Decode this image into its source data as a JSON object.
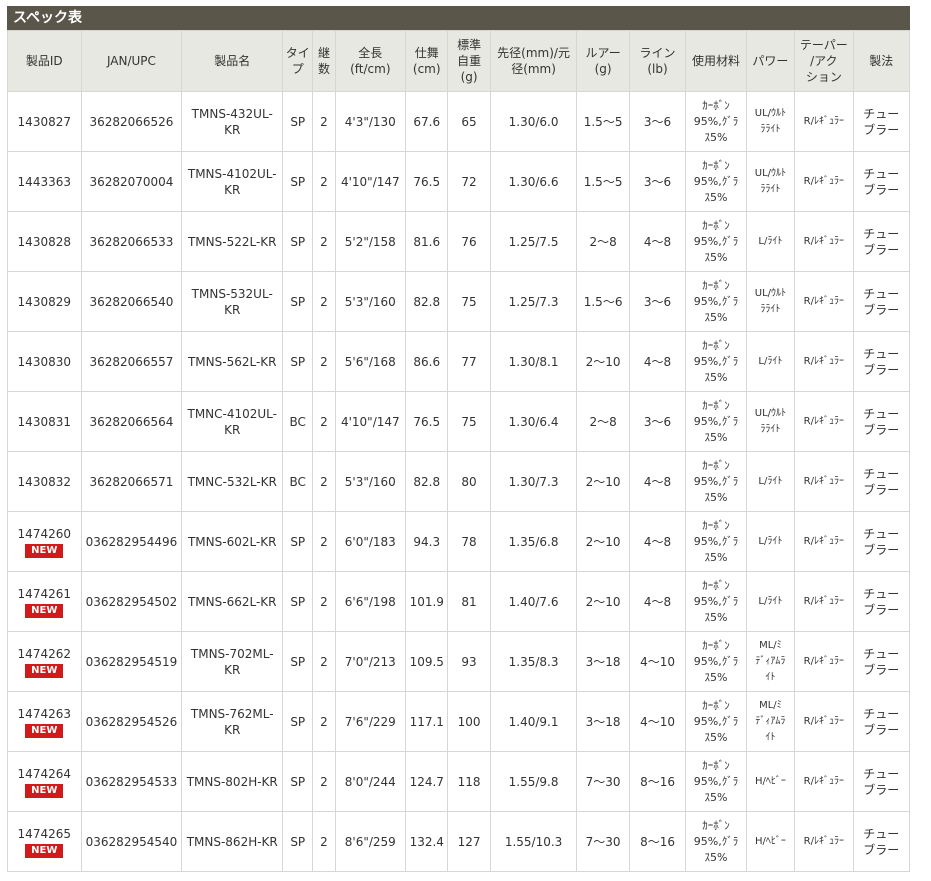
{
  "section_title": "スペック表",
  "headers": [
    "製品ID",
    "JAN/UPC",
    "製品名",
    "タイプ",
    "継数",
    "全長(ft/cm)",
    "仕舞(cm)",
    "標準自重(g)",
    "先径(mm)/元径(mm)",
    "ルアー(g)",
    "ライン(lb)",
    "使用材料",
    "パワー",
    "テーパー/アクション",
    "製法"
  ],
  "header_display": [
    [
      "製品ID"
    ],
    [
      "JAN/UPC"
    ],
    [
      "製品名"
    ],
    [
      "タイ",
      "プ"
    ],
    [
      "継",
      "数"
    ],
    [
      "全長",
      "(ft/cm)"
    ],
    [
      "仕舞",
      "(cm)"
    ],
    [
      "標準",
      "自重",
      "(g)"
    ],
    [
      "先径(mm)/元",
      "径(mm)"
    ],
    [
      "ルアー",
      "(g)"
    ],
    [
      "ライン",
      "(lb)"
    ],
    [
      "使用材料"
    ],
    [
      "パワー"
    ],
    [
      "テーパー",
      "/アク",
      "ション"
    ],
    [
      "製法"
    ]
  ],
  "new_label": "NEW",
  "rows": [
    {
      "id": "1430827",
      "new": false,
      "jan": "36282066526",
      "name": [
        "TMNS-432UL-",
        "KR"
      ],
      "type": "SP",
      "pieces": "2",
      "length": "4'3\"/130",
      "closed": "67.6",
      "weight": "65",
      "dia": "1.30/6.0",
      "lure": "1.5～5",
      "line": "3～6",
      "material": [
        "ｶｰﾎﾞﾝ",
        "95%,ｸﾞﾗ",
        "ｽ5%"
      ],
      "power": [
        "UL/ｳﾙﾄ",
        "ﾗﾗｲﾄ"
      ],
      "taper": "R/ﾚｷﾞｭﾗｰ",
      "method": [
        "チュー",
        "ブラー"
      ]
    },
    {
      "id": "1443363",
      "new": false,
      "jan": "36282070004",
      "name": [
        "TMNS-4102UL-",
        "KR"
      ],
      "type": "SP",
      "pieces": "2",
      "length": "4'10\"/147",
      "closed": "76.5",
      "weight": "72",
      "dia": "1.30/6.6",
      "lure": "1.5～5",
      "line": "3～6",
      "material": [
        "ｶｰﾎﾞﾝ",
        "95%,ｸﾞﾗ",
        "ｽ5%"
      ],
      "power": [
        "UL/ｳﾙﾄ",
        "ﾗﾗｲﾄ"
      ],
      "taper": "R/ﾚｷﾞｭﾗｰ",
      "method": [
        "チュー",
        "ブラー"
      ]
    },
    {
      "id": "1430828",
      "new": false,
      "jan": "36282066533",
      "name": [
        "TMNS-522L-KR"
      ],
      "type": "SP",
      "pieces": "2",
      "length": "5'2\"/158",
      "closed": "81.6",
      "weight": "76",
      "dia": "1.25/7.5",
      "lure": "2～8",
      "line": "4～8",
      "material": [
        "ｶｰﾎﾞﾝ",
        "95%,ｸﾞﾗ",
        "ｽ5%"
      ],
      "power": [
        "L/ﾗｲﾄ"
      ],
      "taper": "R/ﾚｷﾞｭﾗｰ",
      "method": [
        "チュー",
        "ブラー"
      ]
    },
    {
      "id": "1430829",
      "new": false,
      "jan": "36282066540",
      "name": [
        "TMNS-532UL-",
        "KR"
      ],
      "type": "SP",
      "pieces": "2",
      "length": "5'3\"/160",
      "closed": "82.8",
      "weight": "75",
      "dia": "1.25/7.3",
      "lure": "1.5～6",
      "line": "3～6",
      "material": [
        "ｶｰﾎﾞﾝ",
        "95%,ｸﾞﾗ",
        "ｽ5%"
      ],
      "power": [
        "UL/ｳﾙﾄ",
        "ﾗﾗｲﾄ"
      ],
      "taper": "R/ﾚｷﾞｭﾗｰ",
      "method": [
        "チュー",
        "ブラー"
      ]
    },
    {
      "id": "1430830",
      "new": false,
      "jan": "36282066557",
      "name": [
        "TMNS-562L-KR"
      ],
      "type": "SP",
      "pieces": "2",
      "length": "5'6\"/168",
      "closed": "86.6",
      "weight": "77",
      "dia": "1.30/8.1",
      "lure": "2～10",
      "line": "4～8",
      "material": [
        "ｶｰﾎﾞﾝ",
        "95%,ｸﾞﾗ",
        "ｽ5%"
      ],
      "power": [
        "L/ﾗｲﾄ"
      ],
      "taper": "R/ﾚｷﾞｭﾗｰ",
      "method": [
        "チュー",
        "ブラー"
      ]
    },
    {
      "id": "1430831",
      "new": false,
      "jan": "36282066564",
      "name": [
        "TMNC-4102UL-",
        "KR"
      ],
      "type": "BC",
      "pieces": "2",
      "length": "4'10\"/147",
      "closed": "76.5",
      "weight": "75",
      "dia": "1.30/6.4",
      "lure": "2～8",
      "line": "3～6",
      "material": [
        "ｶｰﾎﾞﾝ",
        "95%,ｸﾞﾗ",
        "ｽ5%"
      ],
      "power": [
        "UL/ｳﾙﾄ",
        "ﾗﾗｲﾄ"
      ],
      "taper": "R/ﾚｷﾞｭﾗｰ",
      "method": [
        "チュー",
        "ブラー"
      ]
    },
    {
      "id": "1430832",
      "new": false,
      "jan": "36282066571",
      "name": [
        "TMNC-532L-KR"
      ],
      "type": "BC",
      "pieces": "2",
      "length": "5'3\"/160",
      "closed": "82.8",
      "weight": "80",
      "dia": "1.30/7.3",
      "lure": "2～10",
      "line": "4～8",
      "material": [
        "ｶｰﾎﾞﾝ",
        "95%,ｸﾞﾗ",
        "ｽ5%"
      ],
      "power": [
        "L/ﾗｲﾄ"
      ],
      "taper": "R/ﾚｷﾞｭﾗｰ",
      "method": [
        "チュー",
        "ブラー"
      ]
    },
    {
      "id": "1474260",
      "new": true,
      "jan": "036282954496",
      "name": [
        "TMNS-602L-KR"
      ],
      "type": "SP",
      "pieces": "2",
      "length": "6'0\"/183",
      "closed": "94.3",
      "weight": "78",
      "dia": "1.35/6.8",
      "lure": "2～10",
      "line": "4～8",
      "material": [
        "ｶｰﾎﾞﾝ",
        "95%,ｸﾞﾗ",
        "ｽ5%"
      ],
      "power": [
        "L/ﾗｲﾄ"
      ],
      "taper": "R/ﾚｷﾞｭﾗｰ",
      "method": [
        "チュー",
        "ブラー"
      ]
    },
    {
      "id": "1474261",
      "new": true,
      "jan": "036282954502",
      "name": [
        "TMNS-662L-KR"
      ],
      "type": "SP",
      "pieces": "2",
      "length": "6'6\"/198",
      "closed": "101.9",
      "weight": "81",
      "dia": "1.40/7.6",
      "lure": "2～10",
      "line": "4～8",
      "material": [
        "ｶｰﾎﾞﾝ",
        "95%,ｸﾞﾗ",
        "ｽ5%"
      ],
      "power": [
        "L/ﾗｲﾄ"
      ],
      "taper": "R/ﾚｷﾞｭﾗｰ",
      "method": [
        "チュー",
        "ブラー"
      ]
    },
    {
      "id": "1474262",
      "new": true,
      "jan": "036282954519",
      "name": [
        "TMNS-702ML-",
        "KR"
      ],
      "type": "SP",
      "pieces": "2",
      "length": "7'0\"/213",
      "closed": "109.5",
      "weight": "93",
      "dia": "1.35/8.3",
      "lure": "3～18",
      "line": "4～10",
      "material": [
        "ｶｰﾎﾞﾝ",
        "95%,ｸﾞﾗ",
        "ｽ5%"
      ],
      "power": [
        "ML/ﾐ",
        "ﾃﾞｨｱﾑﾗ",
        "ｲﾄ"
      ],
      "taper": "R/ﾚｷﾞｭﾗｰ",
      "method": [
        "チュー",
        "ブラー"
      ]
    },
    {
      "id": "1474263",
      "new": true,
      "jan": "036282954526",
      "name": [
        "TMNS-762ML-",
        "KR"
      ],
      "type": "SP",
      "pieces": "2",
      "length": "7'6\"/229",
      "closed": "117.1",
      "weight": "100",
      "dia": "1.40/9.1",
      "lure": "3～18",
      "line": "4～10",
      "material": [
        "ｶｰﾎﾞﾝ",
        "95%,ｸﾞﾗ",
        "ｽ5%"
      ],
      "power": [
        "ML/ﾐ",
        "ﾃﾞｨｱﾑﾗ",
        "ｲﾄ"
      ],
      "taper": "R/ﾚｷﾞｭﾗｰ",
      "method": [
        "チュー",
        "ブラー"
      ]
    },
    {
      "id": "1474264",
      "new": true,
      "jan": "036282954533",
      "name": [
        "TMNS-802H-KR"
      ],
      "type": "SP",
      "pieces": "2",
      "length": "8'0\"/244",
      "closed": "124.7",
      "weight": "118",
      "dia": "1.55/9.8",
      "lure": "7～30",
      "line": "8～16",
      "material": [
        "ｶｰﾎﾞﾝ",
        "95%,ｸﾞﾗ",
        "ｽ5%"
      ],
      "power": [
        "H/ﾍﾋﾞｰ"
      ],
      "taper": "R/ﾚｷﾞｭﾗｰ",
      "method": [
        "チュー",
        "ブラー"
      ]
    },
    {
      "id": "1474265",
      "new": true,
      "jan": "036282954540",
      "name": [
        "TMNS-862H-KR"
      ],
      "type": "SP",
      "pieces": "2",
      "length": "8'6\"/259",
      "closed": "132.4",
      "weight": "127",
      "dia": "1.55/10.3",
      "lure": "7～30",
      "line": "8～16",
      "material": [
        "ｶｰﾎﾞﾝ",
        "95%,ｸﾞﾗ",
        "ｽ5%"
      ],
      "power": [
        "H/ﾍﾋﾞｰ"
      ],
      "taper": "R/ﾚｷﾞｭﾗｰ",
      "method": [
        "チュー",
        "ブラー"
      ]
    }
  ],
  "colors": {
    "title_bg": "#5a5649",
    "header_bg": "#e8e8e2",
    "border": "#d6d6d6",
    "new_badge": "#d31a1a"
  }
}
